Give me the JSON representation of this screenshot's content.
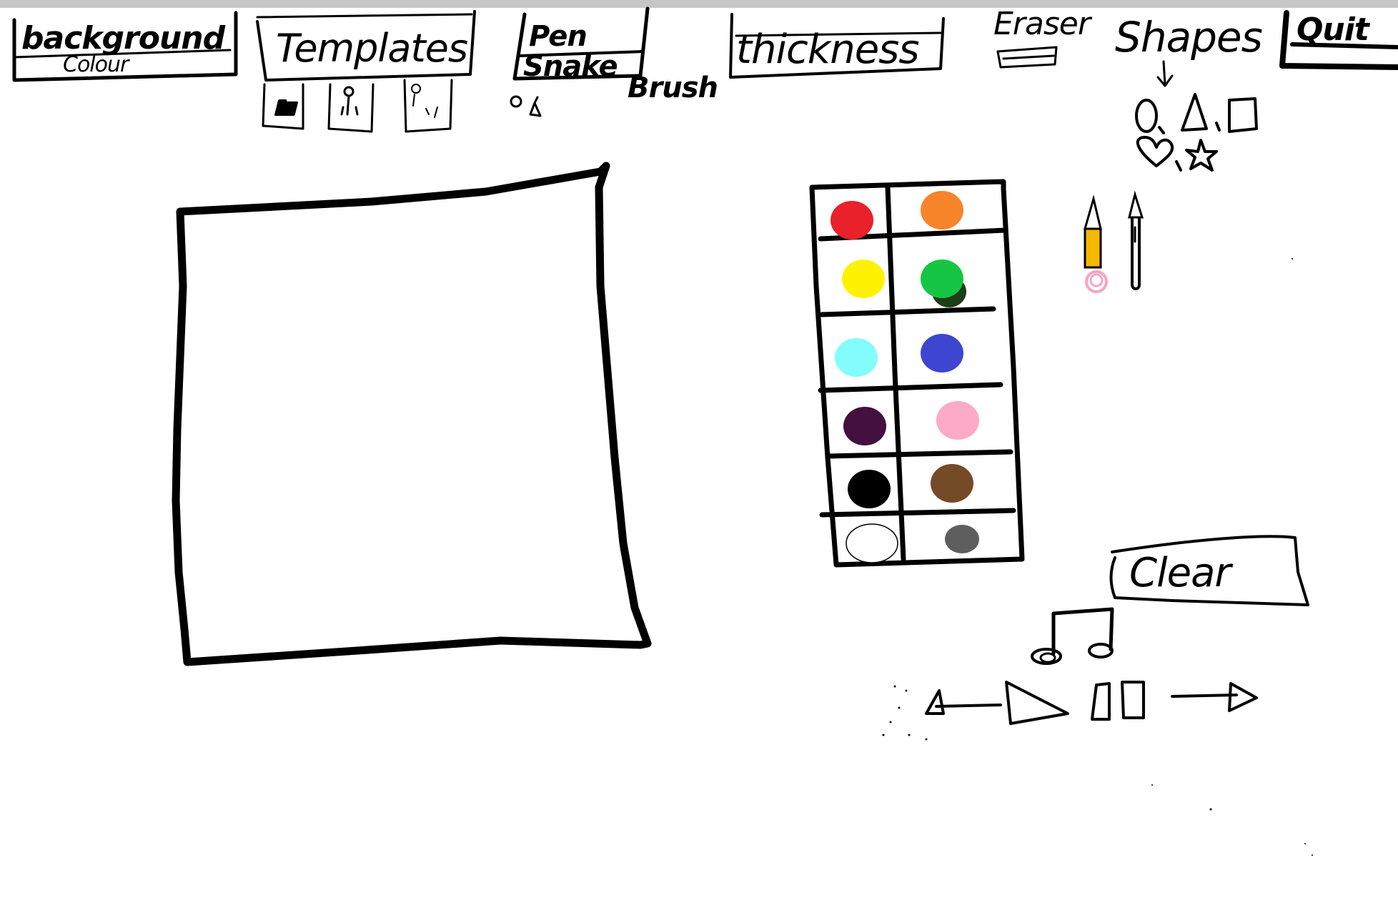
{
  "toolbar": {
    "background_label": "background",
    "background_sublabel": "Colour",
    "templates_label": "Templates",
    "pen_label": "Pen",
    "pen_sublabel": "Snake",
    "brush_label": "Brush",
    "thickness_label": "thickness",
    "eraser_label": "Eraser",
    "shapes_label": "Shapes",
    "quit_label": "Quit"
  },
  "templates": [
    {
      "name": "template-1",
      "icon": "figure-icon"
    },
    {
      "name": "template-2",
      "icon": "figure-icon"
    },
    {
      "name": "template-3",
      "icon": "figure-icon"
    }
  ],
  "shapes": [
    "circle-icon",
    "triangle-icon",
    "square-icon",
    "heart-icon",
    "star-icon"
  ],
  "palette": [
    {
      "name": "red",
      "color": "#e8212a"
    },
    {
      "name": "orange",
      "color": "#f7842a"
    },
    {
      "name": "yellow",
      "color": "#fff200"
    },
    {
      "name": "green",
      "color": "#16c544"
    },
    {
      "name": "cyan",
      "color": "#82fdfc"
    },
    {
      "name": "blue",
      "color": "#3e45d1"
    },
    {
      "name": "purple",
      "color": "#43103f"
    },
    {
      "name": "pink",
      "color": "#fda9c8"
    },
    {
      "name": "black",
      "color": "#000000"
    },
    {
      "name": "brown",
      "color": "#744a27"
    },
    {
      "name": "white",
      "color": "#ffffff"
    },
    {
      "name": "gray",
      "color": "#5e5e5e"
    }
  ],
  "clear_label": "Clear",
  "tools": [
    "pencil-icon",
    "brush-icon"
  ],
  "playback": [
    "back-arrow-icon",
    "play-icon",
    "pause-icon",
    "forward-arrow-icon"
  ],
  "music_icon": "music-note-icon",
  "colors": {
    "ink": "#000000",
    "topbar": "#c6c6c6",
    "pencil_body": "#f5b800",
    "pencil_eraser": "#f7a3c4"
  }
}
